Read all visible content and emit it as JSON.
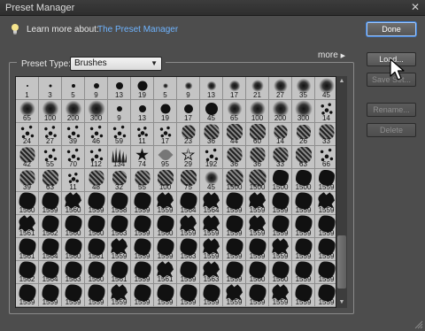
{
  "window": {
    "title": "Preset Manager",
    "close_glyph": "✕"
  },
  "learn": {
    "label": "Learn more about:",
    "link": "The Preset Manager",
    "icon": "lightbulb-icon"
  },
  "preset_type": {
    "label": "Preset Type:",
    "value": "Brushes"
  },
  "more": {
    "label": "more"
  },
  "buttons": {
    "done": "Done",
    "load": "Load...",
    "save_set": "Save Set...",
    "rename": "Rename...",
    "delete": "Delete"
  },
  "brushes": [
    {
      "n": "1",
      "s": "dot",
      "w": 2
    },
    {
      "n": "3",
      "s": "dot",
      "w": 3
    },
    {
      "n": "5",
      "s": "dot",
      "w": 4
    },
    {
      "n": "9",
      "s": "dot",
      "w": 6
    },
    {
      "n": "13",
      "s": "dot",
      "w": 8
    },
    {
      "n": "19",
      "s": "dot",
      "w": 11
    },
    {
      "n": "5",
      "s": "soft",
      "w": 6
    },
    {
      "n": "9",
      "s": "soft",
      "w": 9
    },
    {
      "n": "13",
      "s": "soft",
      "w": 11
    },
    {
      "n": "17",
      "s": "soft",
      "w": 13
    },
    {
      "n": "21",
      "s": "soft",
      "w": 14
    },
    {
      "n": "27",
      "s": "soft",
      "w": 16
    },
    {
      "n": "35",
      "s": "soft",
      "w": 17
    },
    {
      "n": "45",
      "s": "soft",
      "w": 18
    },
    {
      "n": "65",
      "s": "soft",
      "w": 18
    },
    {
      "n": "100",
      "s": "soft",
      "w": 19
    },
    {
      "n": "200",
      "s": "soft",
      "w": 19
    },
    {
      "n": "300",
      "s": "soft",
      "w": 20
    },
    {
      "n": "9",
      "s": "dot",
      "w": 6
    },
    {
      "n": "13",
      "s": "dot",
      "w": 8
    },
    {
      "n": "19",
      "s": "dot",
      "w": 11
    },
    {
      "n": "17",
      "s": "dot",
      "w": 10
    },
    {
      "n": "45",
      "s": "dot",
      "w": 14
    },
    {
      "n": "65",
      "s": "soft",
      "w": 17
    },
    {
      "n": "100",
      "s": "soft",
      "w": 18
    },
    {
      "n": "200",
      "s": "soft",
      "w": 19
    },
    {
      "n": "300",
      "s": "soft",
      "w": 20
    },
    {
      "n": "14",
      "s": "scatter",
      "w": 16
    },
    {
      "n": "24",
      "s": "scatter",
      "w": 18
    },
    {
      "n": "27",
      "s": "scatter",
      "w": 17
    },
    {
      "n": "39",
      "s": "scatter",
      "w": 18
    },
    {
      "n": "46",
      "s": "scatter",
      "w": 18
    },
    {
      "n": "59",
      "s": "scatter",
      "w": 18
    },
    {
      "n": "11",
      "s": "scatter",
      "w": 14
    },
    {
      "n": "17",
      "s": "scatter",
      "w": 15
    },
    {
      "n": "23",
      "s": "texture",
      "w": 15
    },
    {
      "n": "36",
      "s": "texture",
      "w": 17
    },
    {
      "n": "44",
      "s": "texture",
      "w": 18
    },
    {
      "n": "60",
      "s": "texture",
      "w": 18
    },
    {
      "n": "14",
      "s": "texture",
      "w": 15
    },
    {
      "n": "26",
      "s": "texture",
      "w": 16
    },
    {
      "n": "33",
      "s": "texture",
      "w": 17
    },
    {
      "n": "42",
      "s": "texture",
      "w": 17
    },
    {
      "n": "55",
      "s": "scatter",
      "w": 18
    },
    {
      "n": "70",
      "s": "scatter",
      "w": 18
    },
    {
      "n": "112",
      "s": "scatter",
      "w": 18
    },
    {
      "n": "134",
      "s": "grass",
      "w": 17
    },
    {
      "n": "74",
      "s": "star",
      "w": 15
    },
    {
      "n": "95",
      "s": "leaf",
      "w": 12
    },
    {
      "n": "29",
      "s": "starout",
      "w": 16
    },
    {
      "n": "192",
      "s": "scatter",
      "w": 18
    },
    {
      "n": "36",
      "s": "texture",
      "w": 17
    },
    {
      "n": "36",
      "s": "texture",
      "w": 17
    },
    {
      "n": "33",
      "s": "texture",
      "w": 17
    },
    {
      "n": "63",
      "s": "texture",
      "w": 18
    },
    {
      "n": "66",
      "s": "scatter",
      "w": 18
    },
    {
      "n": "39",
      "s": "texture",
      "w": 17
    },
    {
      "n": "63",
      "s": "texture",
      "w": 18
    },
    {
      "n": "11",
      "s": "scatter",
      "w": 14
    },
    {
      "n": "48",
      "s": "texture",
      "w": 17
    },
    {
      "n": "32",
      "s": "texture",
      "w": 16
    },
    {
      "n": "55",
      "s": "texture",
      "w": 17
    },
    {
      "n": "100",
      "s": "texture",
      "w": 18
    },
    {
      "n": "75",
      "s": "texture",
      "w": 18
    },
    {
      "n": "45",
      "s": "soft",
      "w": 16
    },
    {
      "n": "1500",
      "s": "texture",
      "w": 19
    },
    {
      "n": "1500",
      "s": "texture",
      "w": 19
    },
    {
      "n": "1500",
      "s": "blob",
      "w": 18
    },
    {
      "n": "1500",
      "s": "blob",
      "w": 18
    },
    {
      "n": "1559",
      "s": "blob",
      "w": 18
    },
    {
      "n": "1560",
      "s": "blob",
      "w": 19
    },
    {
      "n": "1559",
      "s": "blob",
      "w": 19
    },
    {
      "n": "1560",
      "s": "splat",
      "w": 19
    },
    {
      "n": "1559",
      "s": "blob",
      "w": 19
    },
    {
      "n": "1558",
      "s": "blob",
      "w": 19
    },
    {
      "n": "1559",
      "s": "blob",
      "w": 19
    },
    {
      "n": "1559",
      "s": "splat",
      "w": 19
    },
    {
      "n": "1564",
      "s": "blob",
      "w": 19
    },
    {
      "n": "1564",
      "s": "splat",
      "w": 19
    },
    {
      "n": "1559",
      "s": "blob",
      "w": 19
    },
    {
      "n": "1559",
      "s": "splat",
      "w": 19
    },
    {
      "n": "1559",
      "s": "blob",
      "w": 19
    },
    {
      "n": "1559",
      "s": "blob",
      "w": 19
    },
    {
      "n": "1559",
      "s": "splat",
      "w": 19
    },
    {
      "n": "1561",
      "s": "splat",
      "w": 19
    },
    {
      "n": "1562",
      "s": "blob",
      "w": 19
    },
    {
      "n": "1560",
      "s": "blob",
      "w": 19
    },
    {
      "n": "1560",
      "s": "blob",
      "w": 19
    },
    {
      "n": "1563",
      "s": "blob",
      "w": 19
    },
    {
      "n": "1559",
      "s": "blob",
      "w": 19
    },
    {
      "n": "1560",
      "s": "blob",
      "w": 19
    },
    {
      "n": "1559",
      "s": "splat",
      "w": 19
    },
    {
      "n": "1559",
      "s": "splat",
      "w": 19
    },
    {
      "n": "1559",
      "s": "blob",
      "w": 19
    },
    {
      "n": "1559",
      "s": "splat",
      "w": 19
    },
    {
      "n": "1559",
      "s": "blob",
      "w": 19
    },
    {
      "n": "1559",
      "s": "blob",
      "w": 19
    },
    {
      "n": "1559",
      "s": "blob",
      "w": 19
    },
    {
      "n": "1561",
      "s": "blob",
      "w": 19
    },
    {
      "n": "1564",
      "s": "blob",
      "w": 19
    },
    {
      "n": "1560",
      "s": "blob",
      "w": 19
    },
    {
      "n": "1561",
      "s": "blob",
      "w": 19
    },
    {
      "n": "1559",
      "s": "splat",
      "w": 19
    },
    {
      "n": "1559",
      "s": "blob",
      "w": 19
    },
    {
      "n": "1559",
      "s": "blob",
      "w": 19
    },
    {
      "n": "1563",
      "s": "blob",
      "w": 19
    },
    {
      "n": "1559",
      "s": "splat",
      "w": 19
    },
    {
      "n": "1559",
      "s": "blob",
      "w": 19
    },
    {
      "n": "1559",
      "s": "blob",
      "w": 19
    },
    {
      "n": "1559",
      "s": "splat",
      "w": 19
    },
    {
      "n": "1559",
      "s": "blob",
      "w": 19
    },
    {
      "n": "1559",
      "s": "blob",
      "w": 19
    },
    {
      "n": "1562",
      "s": "blob",
      "w": 19
    },
    {
      "n": "1564",
      "s": "blob",
      "w": 19
    },
    {
      "n": "1563",
      "s": "blob",
      "w": 19
    },
    {
      "n": "1560",
      "s": "blob",
      "w": 19
    },
    {
      "n": "1561",
      "s": "blob",
      "w": 19
    },
    {
      "n": "1559",
      "s": "blob",
      "w": 19
    },
    {
      "n": "1561",
      "s": "splat",
      "w": 19
    },
    {
      "n": "1559",
      "s": "blob",
      "w": 19
    },
    {
      "n": "1563",
      "s": "splat",
      "w": 19
    },
    {
      "n": "1559",
      "s": "blob",
      "w": 19
    },
    {
      "n": "1560",
      "s": "blob",
      "w": 19
    },
    {
      "n": "1560",
      "s": "blob",
      "w": 19
    },
    {
      "n": "1559",
      "s": "blob",
      "w": 19
    },
    {
      "n": "1559",
      "s": "blob",
      "w": 19
    },
    {
      "n": "1559",
      "s": "blob",
      "w": 19
    },
    {
      "n": "1559",
      "s": "blob",
      "w": 19
    },
    {
      "n": "1559",
      "s": "blob",
      "w": 19
    },
    {
      "n": "1559",
      "s": "blob",
      "w": 19
    },
    {
      "n": "1559",
      "s": "splat",
      "w": 19
    },
    {
      "n": "1559",
      "s": "blob",
      "w": 19
    },
    {
      "n": "1559",
      "s": "blob",
      "w": 19
    },
    {
      "n": "1559",
      "s": "blob",
      "w": 19
    },
    {
      "n": "1559",
      "s": "blob",
      "w": 19
    },
    {
      "n": "1559",
      "s": "splat",
      "w": 19
    },
    {
      "n": "1559",
      "s": "blob",
      "w": 19
    },
    {
      "n": "1559",
      "s": "splat",
      "w": 19
    },
    {
      "n": "1559",
      "s": "blob",
      "w": 19
    },
    {
      "n": "1559",
      "s": "blob",
      "w": 19
    }
  ]
}
